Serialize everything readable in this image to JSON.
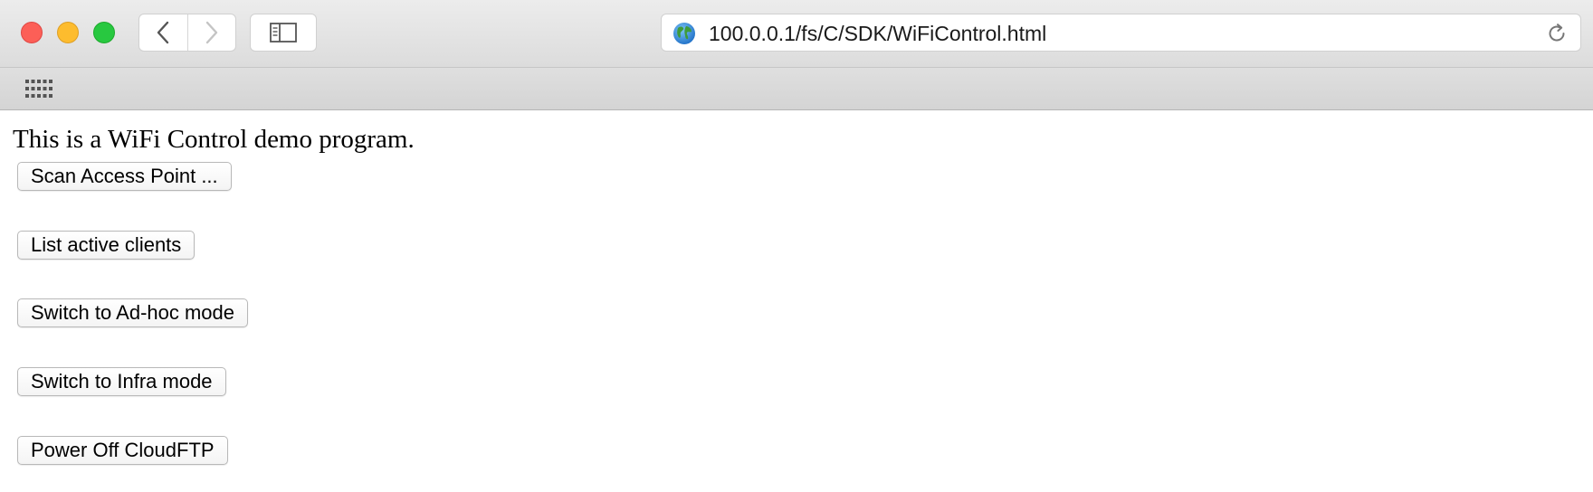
{
  "browser": {
    "url": "100.0.0.1/fs/C/SDK/WiFiControl.html",
    "icons": {
      "back": "chevron-left-icon",
      "forward": "chevron-right-icon",
      "sidebar": "sidebar-icon",
      "site": "globe-icon",
      "reload": "reload-icon",
      "favorites": "grid-icon"
    },
    "colors": {
      "close": "#fc5f57",
      "minimize": "#fdbc2e",
      "maximize": "#28c840"
    }
  },
  "page": {
    "intro": "This is a WiFi Control demo program.",
    "buttons": [
      {
        "label": "Scan Access Point ..."
      },
      {
        "label": "List active clients"
      },
      {
        "label": "Switch to Ad-hoc mode"
      },
      {
        "label": "Switch to Infra mode"
      },
      {
        "label": "Power Off CloudFTP"
      }
    ]
  }
}
